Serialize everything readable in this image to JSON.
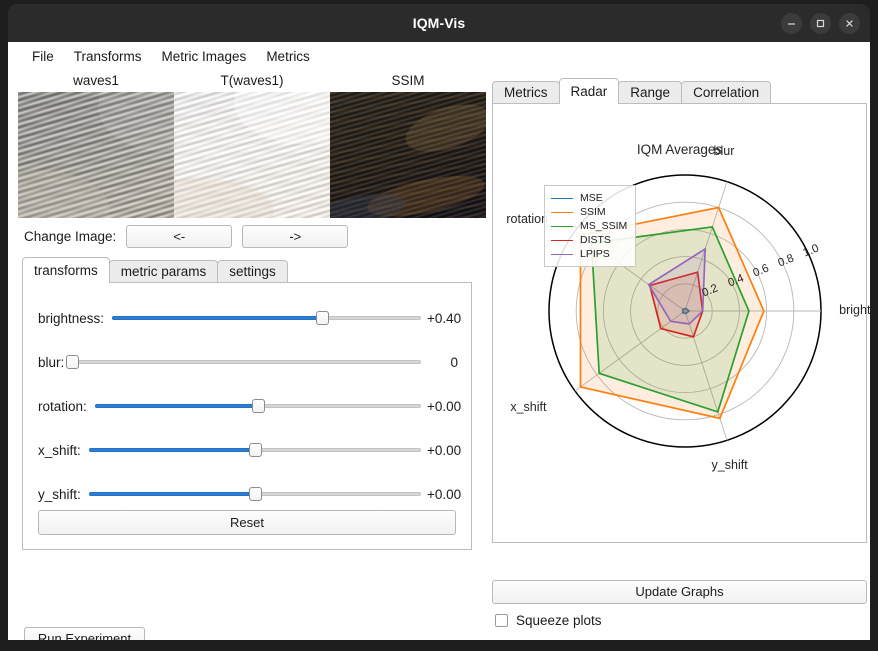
{
  "window": {
    "title": "IQM-Vis",
    "controls": [
      {
        "name": "minimize-button",
        "glyph": "minimize"
      },
      {
        "name": "maximize-button",
        "glyph": "maximize"
      },
      {
        "name": "close-button",
        "glyph": "close"
      }
    ]
  },
  "menubar": {
    "items": [
      "File",
      "Transforms",
      "Metric Images",
      "Metrics"
    ]
  },
  "images": [
    {
      "caption": "waves1",
      "kind": "reference-texture"
    },
    {
      "caption": "T(waves1)",
      "kind": "brightened-texture"
    },
    {
      "caption": "SSIM",
      "kind": "ssim-map"
    }
  ],
  "change_image": {
    "label": "Change Image:",
    "prev_label": "<-",
    "next_label": "->"
  },
  "left_tabs": {
    "tabs": [
      "transforms",
      "metric params",
      "settings"
    ],
    "active": "transforms"
  },
  "sliders": [
    {
      "label": "brightness:",
      "value": "+0.40",
      "fill_pct": 68,
      "handle_pct": 68
    },
    {
      "label": "blur:",
      "value": "0",
      "fill_pct": 0,
      "handle_pct": 0
    },
    {
      "label": "rotation:",
      "value": "+0.00",
      "fill_pct": 50,
      "handle_pct": 50
    },
    {
      "label": "x_shift:",
      "value": "+0.00",
      "fill_pct": 50,
      "handle_pct": 50
    },
    {
      "label": "y_shift:",
      "value": "+0.00",
      "fill_pct": 50,
      "handle_pct": 50
    }
  ],
  "reset_label": "Reset",
  "run_experiment_label": "Run Experiment",
  "right_tabs": {
    "tabs": [
      "Metrics",
      "Radar",
      "Range",
      "Correlation"
    ],
    "active": "Radar"
  },
  "update_graphs_label": "Update Graphs",
  "squeeze_plots": {
    "label": "Squeeze plots",
    "checked": false
  },
  "colors": {
    "accent": "#2a7fd4",
    "mse": "#1f77b4",
    "ssim": "#ff7f0e",
    "ms_ssim": "#2ca02c",
    "dists": "#d62728",
    "lpips": "#9467bd",
    "titlebar": "#2b2b2b"
  },
  "chart_data": {
    "type": "radar",
    "title": "IQM Averages",
    "categories": [
      "brightness",
      "blur",
      "rotation",
      "x_shift",
      "y_shift"
    ],
    "tick_labels": [
      "0.2",
      "0.4",
      "0.6",
      "0.8",
      "1.0"
    ],
    "ticks": [
      0.2,
      0.4,
      0.6,
      0.8,
      1.0
    ],
    "rlim": [
      0,
      1.0
    ],
    "grid": true,
    "legend_position": "upper left",
    "series": [
      {
        "name": "MSE",
        "color": "#1f77b4",
        "values": [
          0.03,
          0.02,
          0.02,
          0.02,
          0.02
        ]
      },
      {
        "name": "SSIM",
        "color": "#ff7f0e",
        "values": [
          0.58,
          0.8,
          0.95,
          0.95,
          0.83
        ]
      },
      {
        "name": "MS_SSIM",
        "color": "#2ca02c",
        "values": [
          0.47,
          0.65,
          0.85,
          0.78,
          0.78
        ]
      },
      {
        "name": "DISTS",
        "color": "#d62728",
        "values": [
          0.13,
          0.3,
          0.32,
          0.22,
          0.2
        ]
      },
      {
        "name": "LPIPS",
        "color": "#9467bd",
        "values": [
          0.13,
          0.48,
          0.33,
          0.13,
          0.1
        ]
      }
    ]
  }
}
